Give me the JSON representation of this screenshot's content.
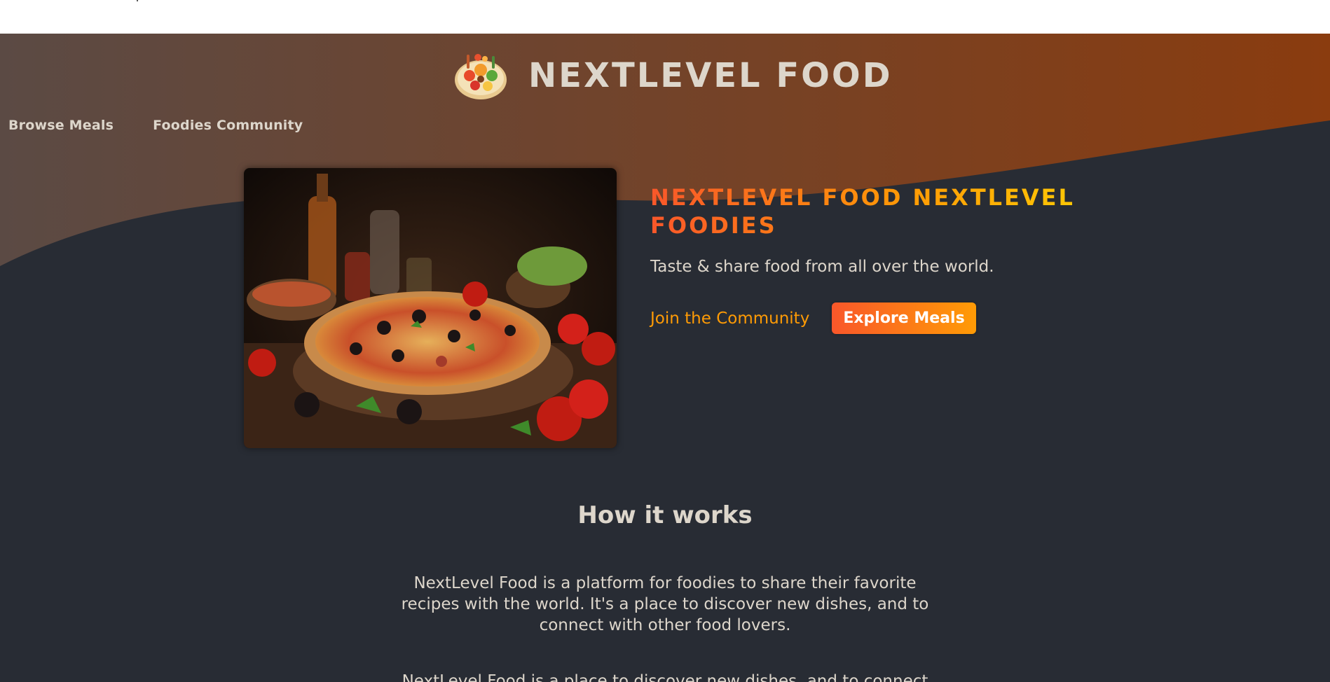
{
  "site": {
    "brand_name": "NEXTLEVEL FOOD"
  },
  "nav": {
    "items": [
      {
        "label": "Browse Meals"
      },
      {
        "label": "Foodies Community"
      }
    ]
  },
  "hero": {
    "title": "NEXTLEVEL FOOD NEXTLEVEL FOODIES",
    "subtitle": "Taste & share food from all over the world.",
    "join_link": "Join the Community",
    "explore_button": "Explore Meals",
    "image_subject": "pizza"
  },
  "how_it_works": {
    "heading": "How it works",
    "paragraphs": [
      "NextLevel Food is a platform for foodies to share their favorite recipes with the world. It's a place to discover new dishes, and to connect with other food lovers.",
      "NextLevel Food is a place to discover new dishes, and to connect with other food lovers."
    ]
  },
  "colors": {
    "background": "#282c34",
    "header_gradient_start": "#5b4a44",
    "header_gradient_end": "#8a3c0f",
    "accent_orange": "#f9572a",
    "accent_gold": "#ff9b05",
    "text": "#ddd6cb"
  }
}
